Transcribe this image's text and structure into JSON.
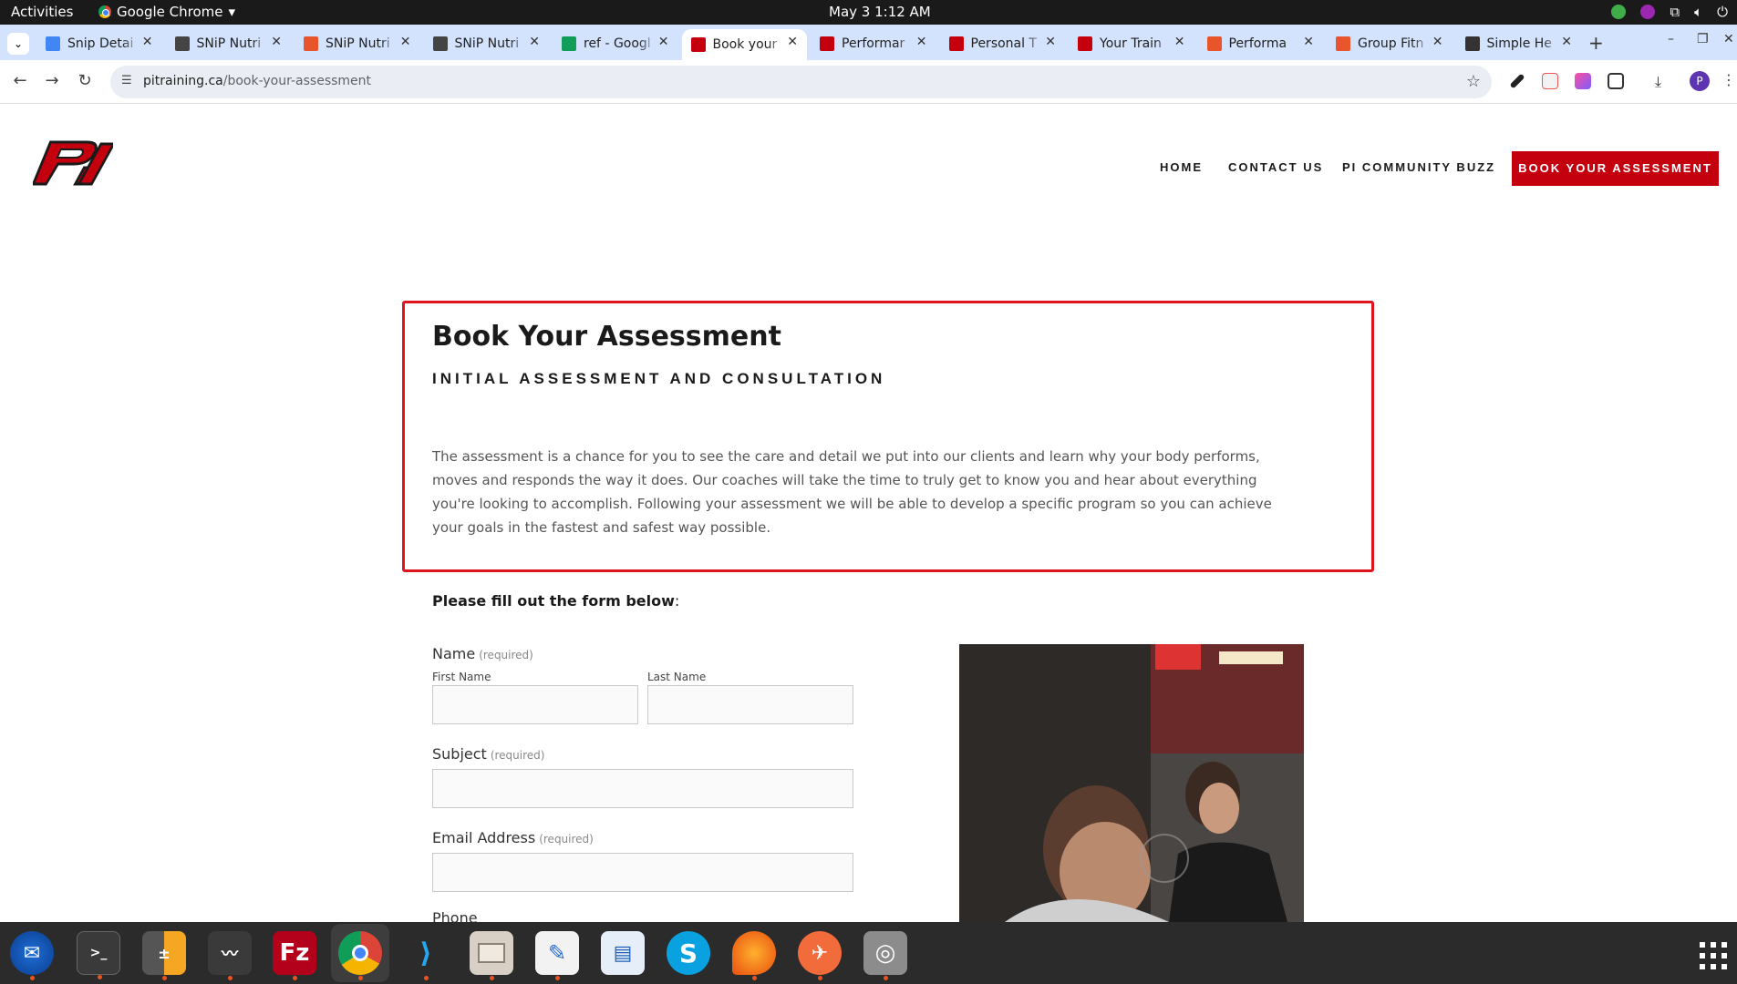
{
  "system_bar": {
    "activities": "Activities",
    "app_name": "Google Chrome",
    "datetime": "May 3  1:12 AM"
  },
  "browser": {
    "tabs": [
      {
        "title": "Snip Detai",
        "icon": "google-docs-icon",
        "color": "#4285f4"
      },
      {
        "title": "SNiP Nutri",
        "icon": "snip-icon",
        "color": "#444444"
      },
      {
        "title": "SNiP Nutri",
        "icon": "snip-food-icon",
        "color": "#e8552d"
      },
      {
        "title": "SNiP Nutri",
        "icon": "snip-icon",
        "color": "#444444"
      },
      {
        "title": "ref - Googl",
        "icon": "google-sheets-icon",
        "color": "#0f9d58"
      },
      {
        "title": "Book your",
        "icon": "pi-icon",
        "color": "#c4000f"
      },
      {
        "title": "Performar",
        "icon": "pi-icon",
        "color": "#c4000f"
      },
      {
        "title": "Personal T",
        "icon": "pi-icon",
        "color": "#c4000f"
      },
      {
        "title": "Your Train",
        "icon": "pi-icon",
        "color": "#c4000f"
      },
      {
        "title": "Performa",
        "icon": "p-square-icon",
        "color": "#e8552d"
      },
      {
        "title": "Group Fitn",
        "icon": "group-fitness-icon",
        "color": "#e8552d"
      },
      {
        "title": "Simple He",
        "icon": "simple-health-icon",
        "color": "#333333"
      }
    ],
    "url_domain": "pitraining.ca",
    "url_path": "/book-your-assessment",
    "profile_initial": "P"
  },
  "site": {
    "nav": {
      "home": "HOME",
      "contact": "CONTACT US",
      "buzz": "PI COMMUNITY BUZZ",
      "cta": "BOOK YOUR ASSESSMENT"
    },
    "title": "Book Your Assessment",
    "subtitle": "INITIAL ASSESSMENT AND CONSULTATION",
    "intro": "The assessment is a chance for you to see the care and detail we put into our clients and learn why your body performs, moves and responds the way it does.  Our coaches will take the time to truly get to know you and hear about everything you're looking to accomplish.  Following your assessment we will be able to develop a specific program so you can achieve your goals in the fastest and safest way possible.",
    "form_lead_bold": "Please fill out the form below",
    "form_lead_tail": ":",
    "form": {
      "name_label": "Name",
      "required": "(required)",
      "first_name": "First Name",
      "last_name": "Last Name",
      "subject_label": "Subject",
      "email_label": "Email Address",
      "phone_label": "Phone"
    }
  },
  "colors": {
    "brand_red": "#c4000f",
    "highlight_red": "#e0141d"
  }
}
